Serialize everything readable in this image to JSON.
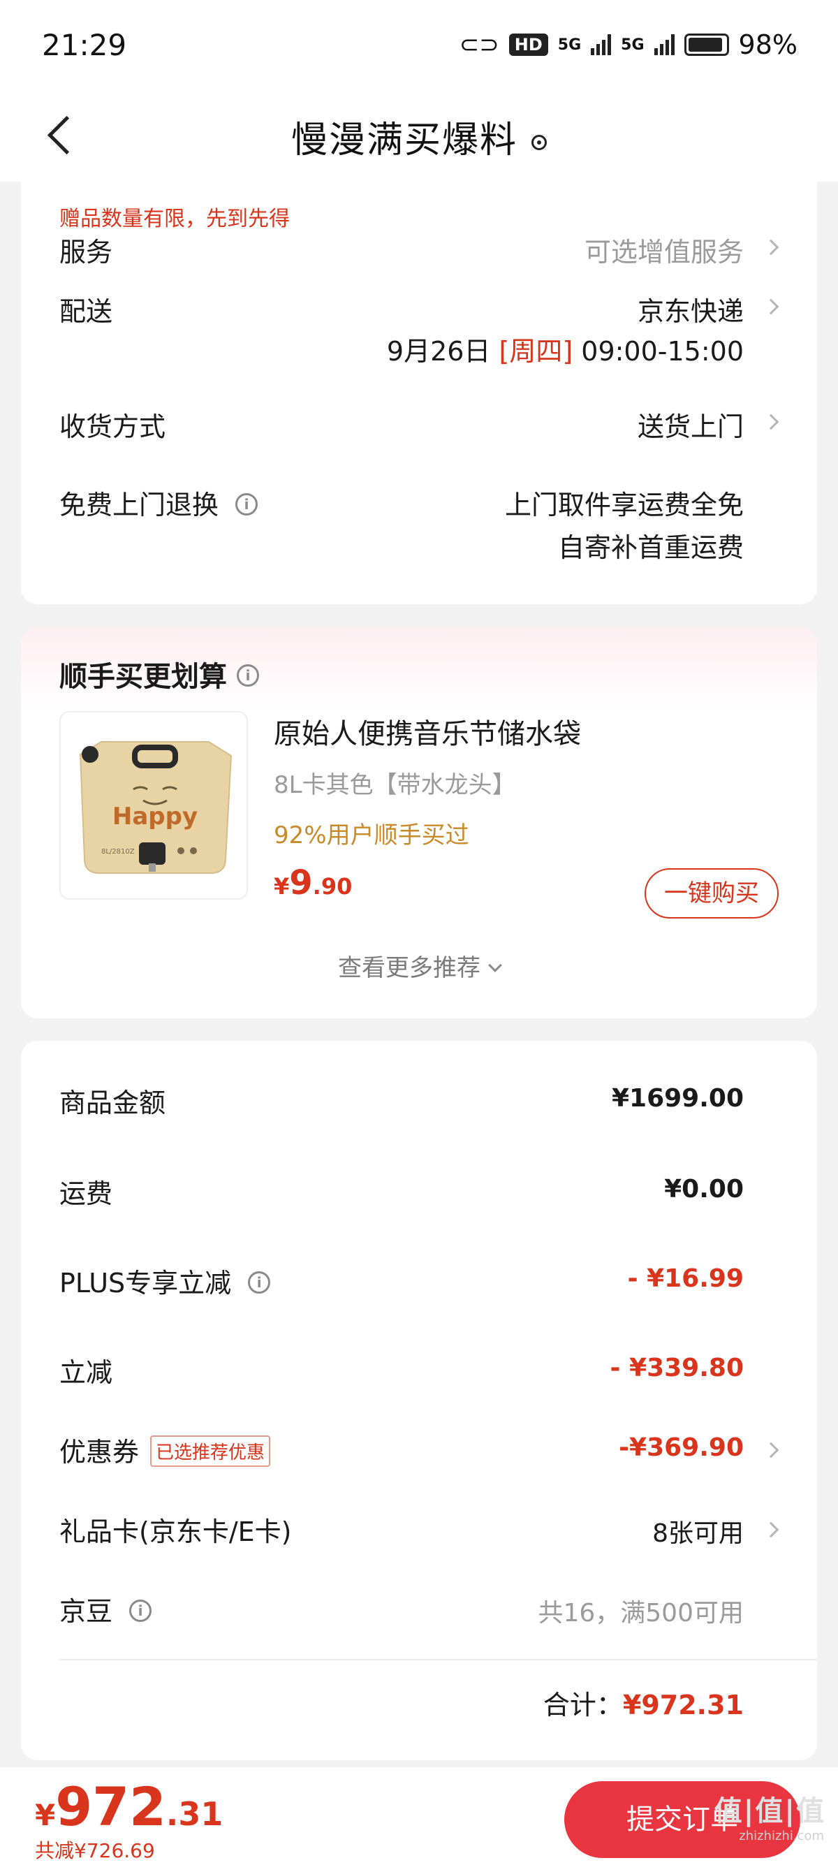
{
  "status_bar": {
    "time": "21:29",
    "hd": "HD",
    "net1": "5G",
    "net2": "5G",
    "battery": "98%"
  },
  "header": {
    "title": "慢漫满买爆料"
  },
  "delivery": {
    "gift_note": "赠品数量有限，先到先得",
    "service_label": "服务",
    "service_value": "可选增值服务",
    "shipping_label": "配送",
    "shipping_value": "京东快递",
    "shipping_date": "9月26日",
    "shipping_weekday": "[周四]",
    "shipping_time": "09:00-15:00",
    "receive_label": "收货方式",
    "receive_value": "送货上门",
    "return_label": "免费上门退换",
    "return_line1": "上门取件享运费全免",
    "return_line2": "自寄补首重运费"
  },
  "recommend": {
    "title": "顺手买更划算",
    "product_name": "原始人便携音乐节储水袋",
    "product_spec": "8L卡其色【带水龙头】",
    "product_bought": "92%用户顺手买过",
    "price_yen": "¥",
    "price_int": "9",
    "price_dec": ".90",
    "buy_button": "一键购买",
    "more": "查看更多推荐",
    "image_text": "Happy",
    "image_small_text": "8L/2810Z"
  },
  "summary": {
    "goods_label": "商品金额",
    "goods_value": "¥1699.00",
    "freight_label": "运费",
    "freight_value": "¥0.00",
    "plus_label": "PLUS专享立减",
    "plus_value": "- ¥16.99",
    "instant_label": "立减",
    "instant_value": "- ¥339.80",
    "coupon_label": "优惠券",
    "coupon_tag": "已选推荐优惠",
    "coupon_value": "-¥369.90",
    "giftcard_label": "礼品卡(京东卡/E卡)",
    "giftcard_value": "8张可用",
    "beans_label": "京豆",
    "beans_value": "共16，满500可用",
    "total_label": "合计：",
    "total_value": "¥972.31"
  },
  "bottom": {
    "price_yen": "¥",
    "price_int": "972",
    "price_dec": ".31",
    "saved": "共减¥726.69",
    "submit": "提交订单",
    "watermark": "值|值|值",
    "watermark_sub": "zhizhizhi.com"
  },
  "colors": {
    "accent_red": "#d9341c",
    "submit_red": "#e8353f",
    "bought_gold": "#c98a2a"
  }
}
